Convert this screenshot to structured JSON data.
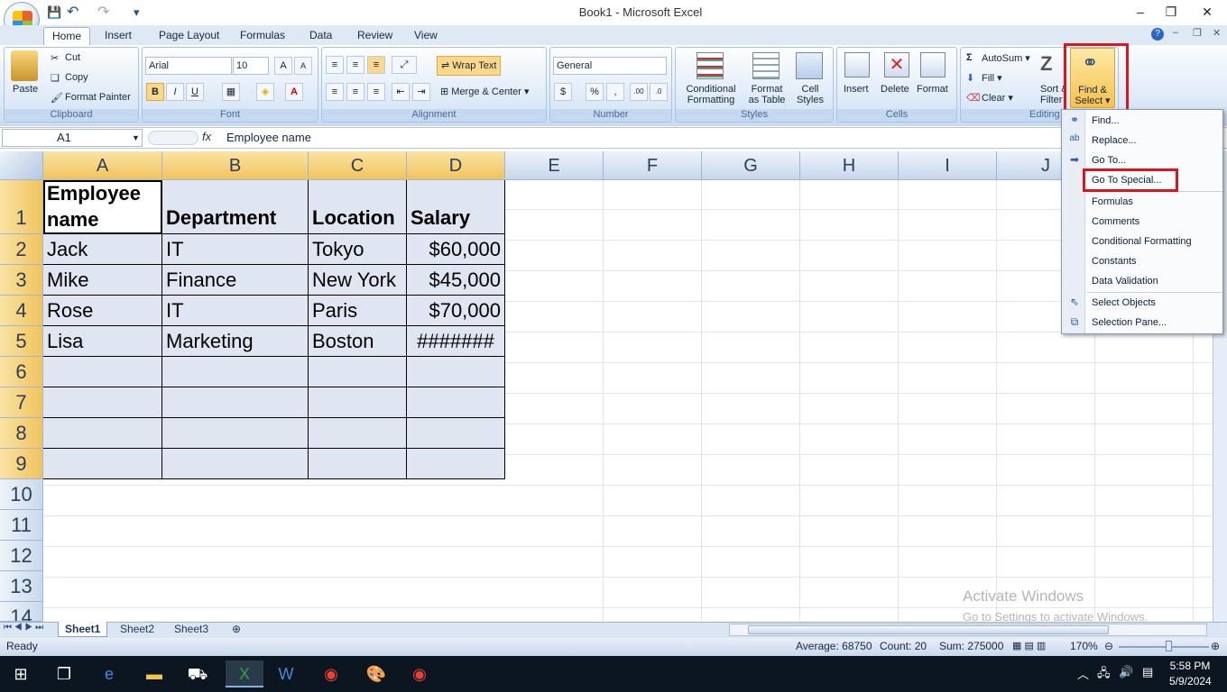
{
  "window": {
    "title": "Book1 - Microsoft Excel",
    "minimize": "–",
    "restore": "❐",
    "close": "✕"
  },
  "qat": {
    "save": "💾",
    "undo": "↶",
    "redo": "↷",
    "more": "▾"
  },
  "tabs": [
    "Home",
    "Insert",
    "Page Layout",
    "Formulas",
    "Data",
    "Review",
    "View"
  ],
  "ribbon": {
    "clipboard": {
      "label": "Clipboard",
      "paste": "Paste",
      "cut": "Cut",
      "copy": "Copy",
      "format_painter": "Format Painter"
    },
    "font": {
      "label": "Font",
      "font_name": "Arial",
      "font_size": "10",
      "bold": "B",
      "italic": "I",
      "underline": "U"
    },
    "alignment": {
      "label": "Alignment",
      "wrap_text": "Wrap Text",
      "merge_center": "Merge & Center"
    },
    "number": {
      "label": "Number",
      "format": "General",
      "currency": "$",
      "percent": "%",
      "comma": ","
    },
    "styles": {
      "label": "Styles",
      "conditional": "Conditional",
      "conditional2": "Formatting",
      "format_table": "Format",
      "format_table2": "as Table",
      "cell_styles": "Cell",
      "cell_styles2": "Styles"
    },
    "cells": {
      "label": "Cells",
      "insert": "Insert",
      "delete": "Delete",
      "format": "Format"
    },
    "editing": {
      "label": "Editing",
      "autosum": "AutoSum",
      "fill": "Fill",
      "clear": "Clear",
      "sort": "Sort &",
      "sort2": "Filter",
      "find": "Find &",
      "find2": "Select"
    }
  },
  "formula_bar": {
    "name_box": "A1",
    "fx": "fx",
    "value": "Employee name"
  },
  "columns": [
    "A",
    "B",
    "C",
    "D",
    "E",
    "F",
    "G",
    "H",
    "I",
    "J"
  ],
  "rows": [
    "1",
    "2",
    "3",
    "4",
    "5",
    "6",
    "7",
    "8",
    "9",
    "10",
    "11",
    "12",
    "13",
    "14"
  ],
  "table": {
    "headers": [
      "Employee name",
      "Department",
      "Location",
      "Salary"
    ],
    "header_line1": "Employee",
    "header_line2": "name",
    "data": [
      [
        "Jack",
        "IT",
        "Tokyo",
        "$60,000"
      ],
      [
        "Mike",
        "Finance",
        "New York",
        "$45,000"
      ],
      [
        "Rose",
        "IT",
        "Paris",
        "$70,000"
      ],
      [
        "Lisa",
        "Marketing",
        "Boston",
        "#######"
      ]
    ]
  },
  "dropdown": {
    "items": [
      "Find...",
      "Replace...",
      "Go To...",
      "Go To Special...",
      "Formulas",
      "Comments",
      "Conditional Formatting",
      "Constants",
      "Data Validation",
      "Select Objects",
      "Selection Pane..."
    ]
  },
  "sheets": [
    "Sheet1",
    "Sheet2",
    "Sheet3"
  ],
  "status": {
    "ready": "Ready",
    "average": "Average: 68750",
    "count": "Count: 20",
    "sum": "Sum: 275000",
    "zoom": "170%"
  },
  "watermark": {
    "line1": "Activate Windows",
    "line2": "Go to Settings to activate Windows."
  },
  "taskbar": {
    "time": "5:58 PM",
    "date": "5/9/2024"
  },
  "colors": {
    "accent_red": "#e0141c",
    "ribbon_blue": "#dce8f6"
  }
}
